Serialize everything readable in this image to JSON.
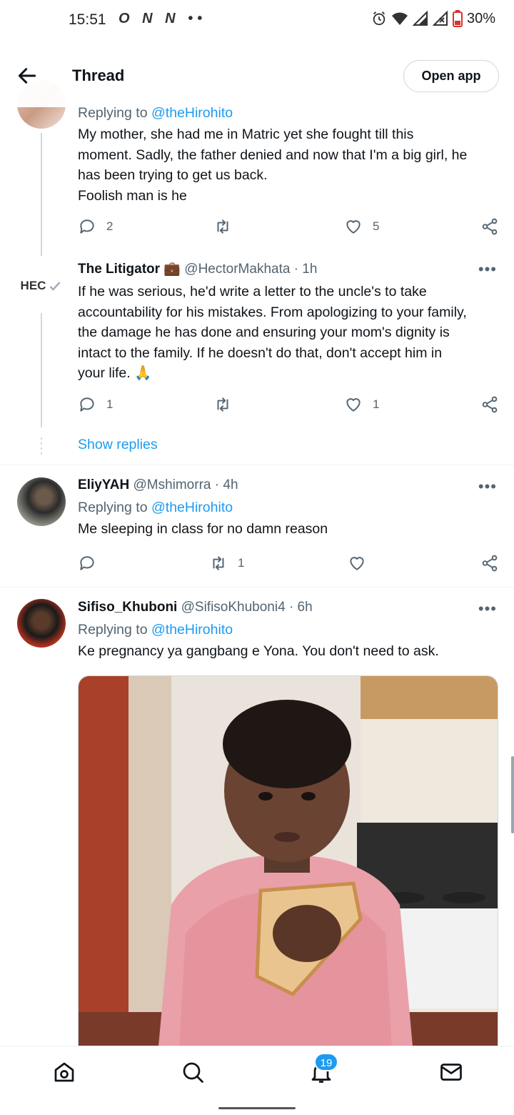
{
  "status_bar": {
    "time": "15:51",
    "left_icons": "O N N ••",
    "battery_percent": "30%"
  },
  "header": {
    "title": "Thread",
    "open_app_label": "Open app"
  },
  "tweets": [
    {
      "replying_prefix": "Replying to ",
      "replying_to": "@theHirohito",
      "text_lines": [
        "My mother, she had me in Matric yet she fought till this",
        "moment. Sadly, the father denied and now that I'm a big girl, he",
        "has been trying to get us back.",
        "Foolish man is he"
      ],
      "replies": "2",
      "retweets": "",
      "likes": "5"
    },
    {
      "name": "The Litigator",
      "name_emoji": "💼",
      "handle": "@HectorMakhata",
      "time": "· 1h",
      "avatar_text": "HEC",
      "text_lines": [
        "If he was serious, he'd write a letter to the uncle's to take",
        "accountability for his mistakes. From apologizing to your family,",
        "the damage he has done and ensuring your mom's dignity is",
        "intact to the family. If he doesn't do that, don't accept him in",
        "your life. 🙏"
      ],
      "replies": "1",
      "retweets": "",
      "likes": "1",
      "show_replies": "Show replies"
    },
    {
      "name": "EliyYAH",
      "handle": "@Mshimorra",
      "time": "· 4h",
      "replying_prefix": "Replying to ",
      "replying_to": "@theHirohito",
      "text": "Me sleeping in class for no damn reason",
      "replies": "",
      "retweets": "1",
      "likes": ""
    },
    {
      "name": "Sifiso_Khuboni",
      "handle": "@SifisoKhuboni4",
      "time": "· 6h",
      "replying_prefix": "Replying to ",
      "replying_to": "@theHirohito",
      "text": "Ke pregnancy ya gangbang e Yona. You don't need to ask."
    }
  ],
  "bottom_nav": {
    "notifications_badge": "19"
  },
  "colors": {
    "accent": "#1d9bf0",
    "secondary_text": "#536471",
    "primary_text": "#0f1419",
    "divider": "#eff3f4"
  },
  "icons": [
    "back-arrow-icon",
    "reply-icon",
    "retweet-icon",
    "like-icon",
    "share-icon",
    "more-icon",
    "home-icon",
    "search-icon",
    "notifications-icon",
    "messages-icon",
    "verified-check-icon",
    "alarm-icon",
    "wifi-icon",
    "signal-icon",
    "battery-icon"
  ]
}
